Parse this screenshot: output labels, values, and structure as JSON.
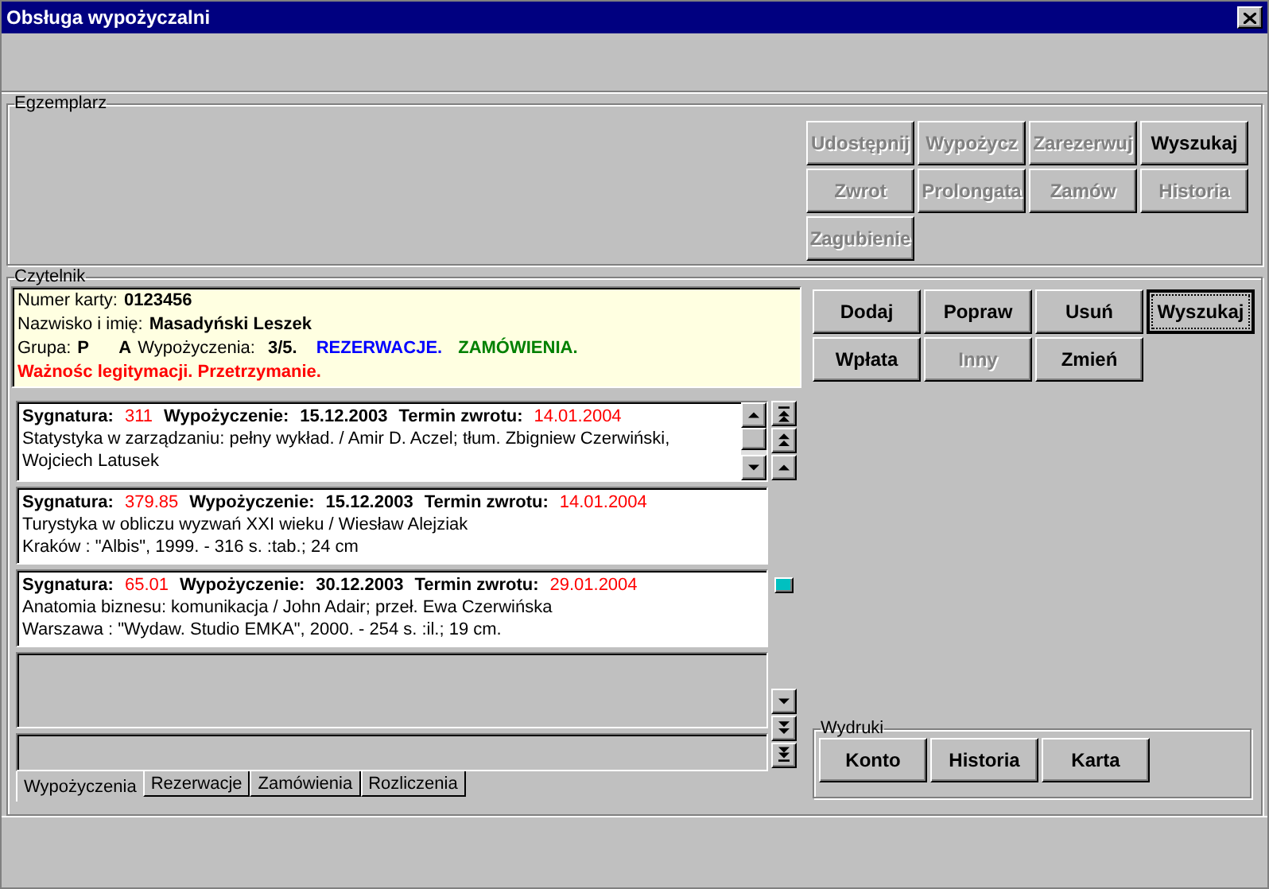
{
  "window": {
    "title": "Obsługa wypożyczalni"
  },
  "egzemplarz": {
    "title": "Egzemplarz",
    "buttons": [
      {
        "label": "Udostępnij",
        "disabled": true,
        "focused": false
      },
      {
        "label": "Wypożycz",
        "disabled": true,
        "focused": false
      },
      {
        "label": "Zarezerwuj",
        "disabled": true,
        "focused": false
      },
      {
        "label": "Wyszukaj",
        "disabled": false,
        "focused": false
      },
      {
        "label": "Zwrot",
        "disabled": true,
        "focused": false
      },
      {
        "label": "Prolongata",
        "disabled": true,
        "focused": false
      },
      {
        "label": "Zamów",
        "disabled": true,
        "focused": false
      },
      {
        "label": "Historia",
        "disabled": true,
        "focused": false
      },
      {
        "label": "Zagubienie",
        "disabled": true,
        "focused": false
      }
    ]
  },
  "czytelnik": {
    "title": "Czytelnik",
    "card": {
      "card_number_label": "Numer karty:",
      "card_number": "0123456",
      "name_label": "Nazwisko i imię:",
      "name": "Masadyński Leszek",
      "group_label": "Grupa:",
      "group": "P",
      "group_2": "A",
      "loans_label": "Wypożyczenia:",
      "loans": "3/5.",
      "reservations": "REZERWACJE.",
      "orders": "ZAMÓWIENIA.",
      "warning": "Ważnośc legitymacji. Przetrzymanie."
    },
    "buttons": [
      {
        "label": "Dodaj",
        "disabled": false,
        "focused": false
      },
      {
        "label": "Popraw",
        "disabled": false,
        "focused": false
      },
      {
        "label": "Usuń",
        "disabled": false,
        "focused": false
      },
      {
        "label": "Wyszukaj",
        "disabled": false,
        "focused": true
      },
      {
        "label": "Wpłata",
        "disabled": false,
        "focused": false
      },
      {
        "label": "Inny",
        "disabled": true,
        "focused": false
      },
      {
        "label": "Zmień",
        "disabled": false,
        "focused": false
      }
    ],
    "loans": [
      {
        "signature_label": "Sygnatura:",
        "signature": "311",
        "loan_label": "Wypożyczenie:",
        "loan_date": "15.12.2003",
        "due_label": "Termin zwrotu:",
        "due_date": "14.01.2004",
        "title": "Statystyka w zarządzaniu: pełny wykład. / Amir D. Aczel; tłum. Zbigniew Czerwiński, Wojciech Latusek",
        "scrollable": true
      },
      {
        "signature_label": "Sygnatura:",
        "signature": "379.85",
        "loan_label": "Wypożyczenie:",
        "loan_date": "15.12.2003",
        "due_label": "Termin zwrotu:",
        "due_date": "14.01.2004",
        "title": "Turystyka w obliczu wyzwań XXI wieku / Wiesław Alejziak",
        "details": "Kraków : \"Albis\", 1999. - 316 s. :tab.; 24 cm",
        "scrollable": false
      },
      {
        "signature_label": "Sygnatura:",
        "signature": "65.01",
        "loan_label": "Wypożyczenie:",
        "loan_date": "30.12.2003",
        "due_label": "Termin zwrotu:",
        "due_date": "29.01.2004",
        "title": "Anatomia biznesu: komunikacja / John Adair; przeł. Ewa Czerwińska",
        "details": "Warszawa : \"Wydaw. Studio EMKA\", 2000. - 254 s. :il.; 19 cm.",
        "scrollable": false
      }
    ],
    "tabs": [
      {
        "label": "Wypożyczenia",
        "selected": true
      },
      {
        "label": "Rezerwacje",
        "selected": false
      },
      {
        "label": "Zamówienia",
        "selected": false
      },
      {
        "label": "Rozliczenia",
        "selected": false
      }
    ],
    "prints": {
      "title": "Wydruki",
      "buttons": [
        {
          "label": "Konto",
          "disabled": false,
          "focused": false
        },
        {
          "label": "Historia",
          "disabled": false,
          "focused": false
        },
        {
          "label": "Karta",
          "disabled": false,
          "focused": false
        }
      ]
    }
  }
}
